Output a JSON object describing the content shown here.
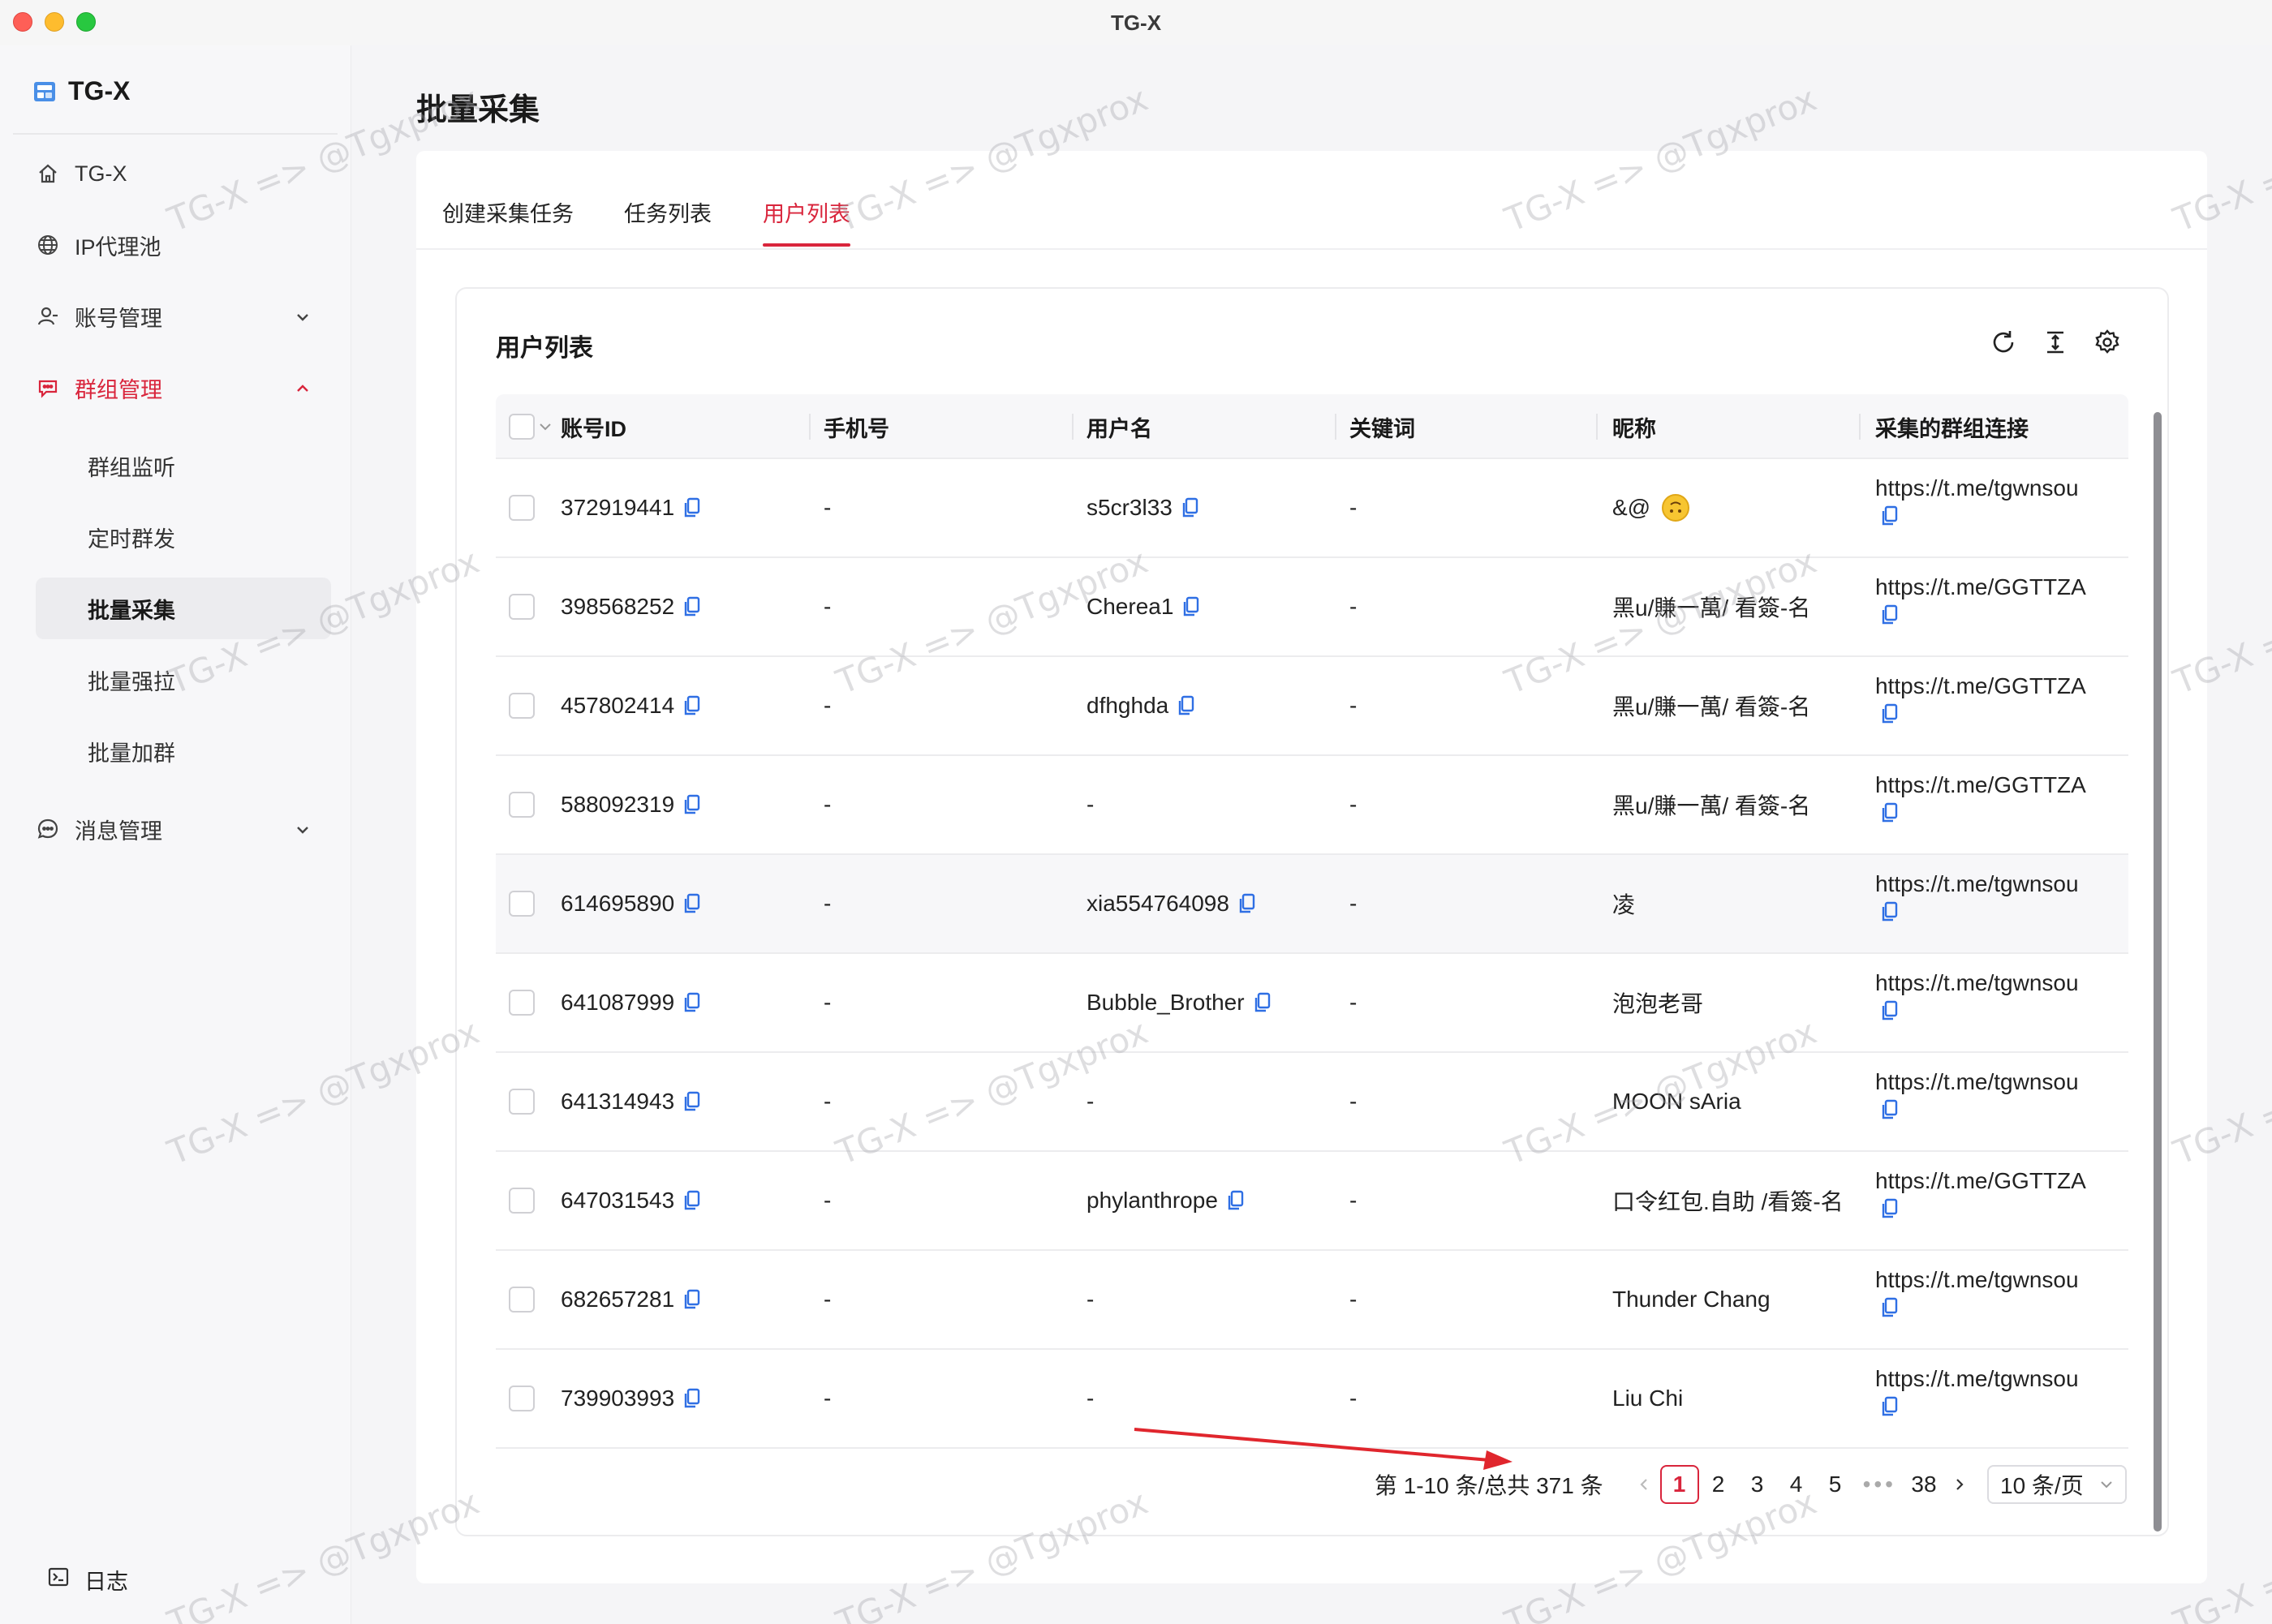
{
  "window": {
    "title": "TG-X"
  },
  "sidebar": {
    "brand": "TG-X",
    "items": [
      {
        "label": "TG-X",
        "icon": "home-icon"
      },
      {
        "label": "IP代理池",
        "icon": "globe-icon"
      },
      {
        "label": "账号管理",
        "icon": "user-icon",
        "expanded": false
      },
      {
        "label": "群组管理",
        "icon": "chat-group-icon",
        "expanded": true,
        "active": true
      },
      {
        "label": "消息管理",
        "icon": "message-icon",
        "expanded": false
      }
    ],
    "group_sub": [
      {
        "label": "群组监听"
      },
      {
        "label": "定时群发"
      },
      {
        "label": "批量采集",
        "selected": true
      },
      {
        "label": "批量强拉"
      },
      {
        "label": "批量加群"
      }
    ],
    "log": "日志"
  },
  "page": {
    "title": "批量采集"
  },
  "tabs": [
    {
      "label": "创建采集任务"
    },
    {
      "label": "任务列表"
    },
    {
      "label": "用户列表",
      "active": true
    }
  ],
  "card": {
    "title": "用户列表"
  },
  "table": {
    "columns": [
      "账号ID",
      "手机号",
      "用户名",
      "关键词",
      "昵称",
      "采集的群组连接"
    ],
    "rows": [
      {
        "id": "372919441",
        "phone": "-",
        "username": "s5cr3l33",
        "username_copy": true,
        "keyword": "-",
        "nickname": "&@",
        "emoji": true,
        "link": "https://t.me/tgwnsou"
      },
      {
        "id": "398568252",
        "phone": "-",
        "username": "Cherea1",
        "username_copy": true,
        "keyword": "-",
        "nickname": "黑u/賺一萬/ 看簽-名",
        "link": "https://t.me/GGTTZA"
      },
      {
        "id": "457802414",
        "phone": "-",
        "username": "dfhghda",
        "username_copy": true,
        "keyword": "-",
        "nickname": "黑u/賺一萬/ 看簽-名",
        "link": "https://t.me/GGTTZA"
      },
      {
        "id": "588092319",
        "phone": "-",
        "username": "-",
        "username_copy": false,
        "keyword": "-",
        "nickname": "黑u/賺一萬/ 看簽-名",
        "link": "https://t.me/GGTTZA"
      },
      {
        "id": "614695890",
        "phone": "-",
        "username": "xia554764098",
        "username_copy": true,
        "keyword": "-",
        "nickname": "凌",
        "link": "https://t.me/tgwnsou",
        "hover": true
      },
      {
        "id": "641087999",
        "phone": "-",
        "username": "Bubble_Brother",
        "username_copy": true,
        "keyword": "-",
        "nickname": "泡泡老哥",
        "link": "https://t.me/tgwnsou"
      },
      {
        "id": "641314943",
        "phone": "-",
        "username": "-",
        "username_copy": false,
        "keyword": "-",
        "nickname": "MOON sAria",
        "link": "https://t.me/tgwnsou"
      },
      {
        "id": "647031543",
        "phone": "-",
        "username": "phylanthrope",
        "username_copy": true,
        "keyword": "-",
        "nickname": "口令红包.自助 /看簽-名",
        "link": "https://t.me/GGTTZA"
      },
      {
        "id": "682657281",
        "phone": "-",
        "username": "-",
        "username_copy": false,
        "keyword": "-",
        "nickname": "Thunder Chang",
        "link": "https://t.me/tgwnsou"
      },
      {
        "id": "739903993",
        "phone": "-",
        "username": "-",
        "username_copy": false,
        "keyword": "-",
        "nickname": "Liu Chi",
        "link": "https://t.me/tgwnsou"
      }
    ]
  },
  "pagination": {
    "summary": "第 1-10 条/总共 371 条",
    "current": "1",
    "pages": [
      "2",
      "3",
      "4",
      "5"
    ],
    "ellipsis": "•••",
    "last": "38",
    "page_size": "10 条/页"
  },
  "watermark": "TG-X => @Tgxprox",
  "colors": {
    "accent": "#d9253c",
    "copy_icon": "#2f6fe4"
  }
}
